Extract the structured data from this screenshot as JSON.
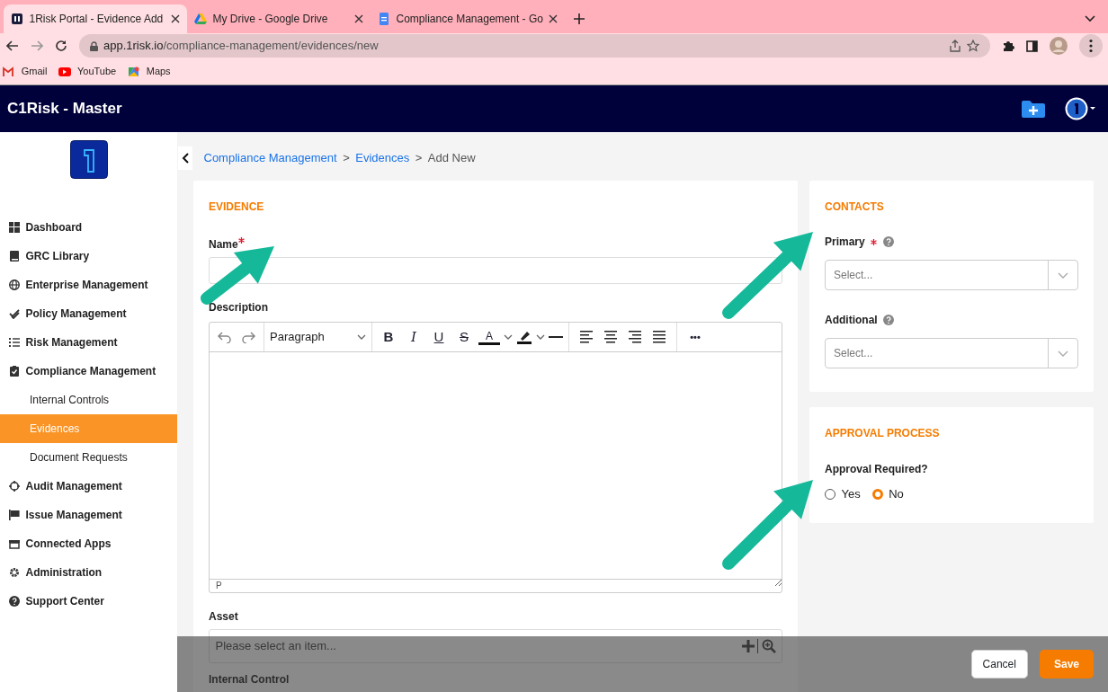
{
  "browser": {
    "tabs": [
      {
        "title": "1Risk Portal - Evidence Add",
        "selected": true
      },
      {
        "title": "My Drive - Google Drive",
        "selected": false
      },
      {
        "title": "Compliance Management - Go",
        "selected": false
      }
    ],
    "url_host": "app.1risk.io",
    "url_path": "/compliance-management/evidences/new",
    "bookmarks": [
      "Gmail",
      "YouTube",
      "Maps"
    ]
  },
  "app": {
    "title": "C1Risk - Master"
  },
  "sidebar": {
    "items": [
      {
        "label": "Dashboard",
        "selected": false
      },
      {
        "label": "GRC Library",
        "selected": false
      },
      {
        "label": "Enterprise Management",
        "selected": false
      },
      {
        "label": "Policy Management",
        "selected": false
      },
      {
        "label": "Risk Management",
        "selected": false
      },
      {
        "label": "Compliance Management",
        "selected": false,
        "children": [
          {
            "label": "Internal Controls",
            "selected": false
          },
          {
            "label": "Evidences",
            "selected": true
          },
          {
            "label": "Document Requests",
            "selected": false
          }
        ]
      },
      {
        "label": "Audit Management",
        "selected": false
      },
      {
        "label": "Issue Management",
        "selected": false
      },
      {
        "label": "Connected Apps",
        "selected": false
      },
      {
        "label": "Administration",
        "selected": false
      },
      {
        "label": "Support Center",
        "selected": false
      }
    ]
  },
  "breadcrumb": [
    {
      "label": "Compliance Management",
      "link": true
    },
    {
      "label": ">",
      "link": false
    },
    {
      "label": "Evidences",
      "link": true
    },
    {
      "label": ">",
      "link": false
    },
    {
      "label": "Add New",
      "link": false
    }
  ],
  "evidence": {
    "title": "EVIDENCE",
    "name": {
      "label": "Name",
      "required": true
    },
    "description": {
      "label": "Description",
      "block_format": "Paragraph",
      "glyphs": [
        "B",
        "I",
        "U",
        "S",
        "A",
        "•••"
      ],
      "status": "P"
    },
    "asset": {
      "label": "Asset",
      "placeholder": "Please select an item..."
    },
    "internal_control": {
      "label": "Internal Control"
    }
  },
  "contacts": {
    "title": "CONTACTS",
    "fields": [
      {
        "label": "Primary",
        "required": true,
        "placeholder": "Select..."
      },
      {
        "label": "Additional",
        "required": false,
        "placeholder": "Select..."
      }
    ]
  },
  "approval": {
    "title": "APPROVAL PROCESS",
    "label": "Approval Required?",
    "options": [
      {
        "label": "Yes",
        "selected": false
      },
      {
        "label": "No",
        "selected": true
      }
    ]
  },
  "footer": {
    "buttons": [
      {
        "label": "Cancel",
        "kind": "secondary"
      },
      {
        "label": "Save",
        "kind": "primary"
      }
    ]
  }
}
